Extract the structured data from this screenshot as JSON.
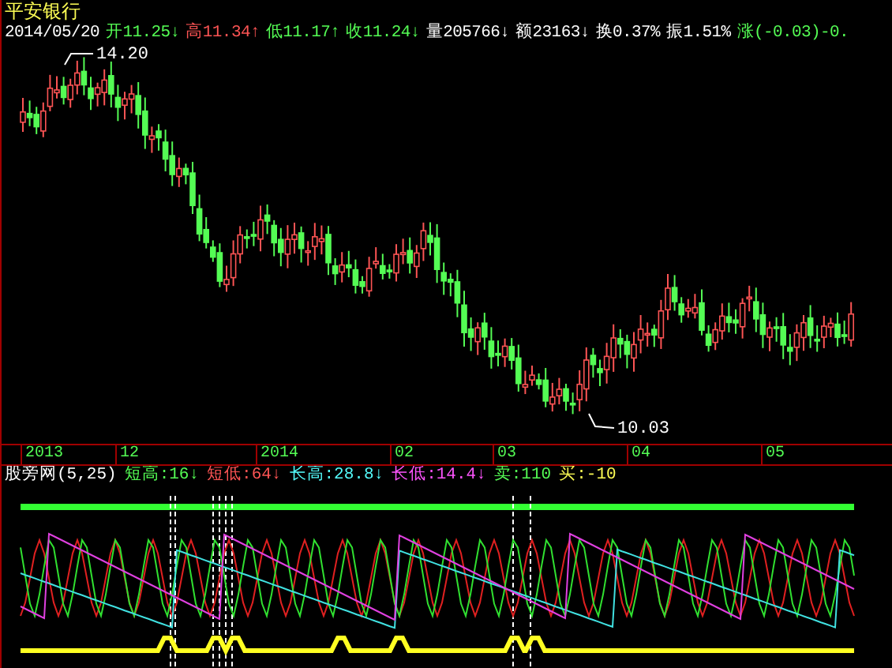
{
  "title": "平安银行",
  "quote": [
    {
      "label": "2014/05/20",
      "color": "#ffffff"
    },
    {
      "label": "开",
      "value": "11.25",
      "arrow": "↓",
      "color": "#54fc54"
    },
    {
      "label": "高",
      "value": "11.34",
      "arrow": "↑",
      "color": "#fc5454"
    },
    {
      "label": "低",
      "value": "11.17",
      "arrow": "↑",
      "color": "#54fc54"
    },
    {
      "label": "收",
      "value": "11.24",
      "arrow": "↓",
      "color": "#54fc54"
    },
    {
      "label": "量",
      "value": "205766",
      "arrow": "↓",
      "color": "#ffffff"
    },
    {
      "label": "额",
      "value": "23163",
      "arrow": "↓",
      "color": "#ffffff"
    },
    {
      "label": "换",
      "value": "0.37%",
      "color": "#ffffff"
    },
    {
      "label": "振",
      "value": "1.51%",
      "color": "#ffffff"
    },
    {
      "label": "涨",
      "value": "(-0.03)-0.",
      "color": "#54fc54"
    }
  ],
  "price_labels": [
    {
      "text": "14.20"
    },
    {
      "text": "10.03"
    }
  ],
  "date_axis": [
    "2013",
    "12",
    "2014",
    "02",
    "03",
    "04",
    "05"
  ],
  "indicator": {
    "name": "股旁网(5,25)",
    "values": [
      {
        "label": "短高:16",
        "arrow": "↓",
        "color": "#54fc54"
      },
      {
        "label": "短低:64",
        "arrow": "↓",
        "color": "#fc5454"
      },
      {
        "label": "长高:28.8",
        "arrow": "↓",
        "color": "#54fcfc"
      },
      {
        "label": "长低:14.4",
        "arrow": "↓",
        "color": "#fc54fc"
      },
      {
        "label": "卖:110",
        "color": "#54fc54"
      },
      {
        "label": "买:-10",
        "color": "#fcfc54"
      }
    ]
  }
}
